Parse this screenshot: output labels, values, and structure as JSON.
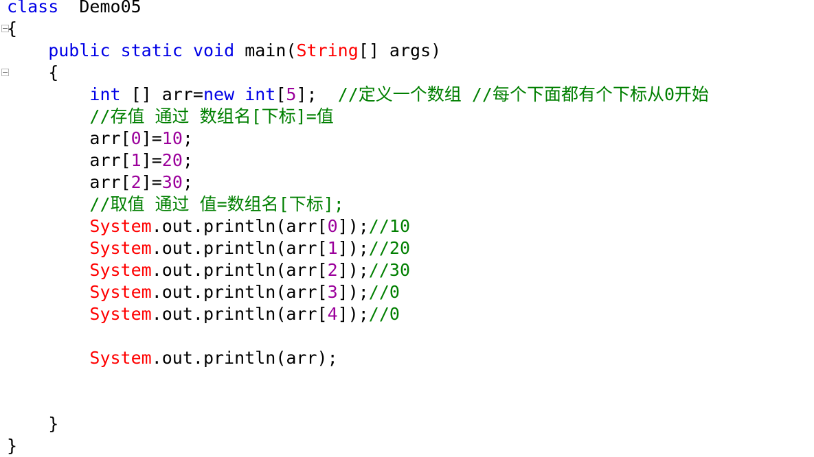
{
  "editor": {
    "language": "java",
    "class_name": "Demo05",
    "colors": {
      "background": "#FFFFFF",
      "plain_text": "#000000",
      "keyword": "#0000E6",
      "type_reference": "#FF0000",
      "number_literal": "#9B009B",
      "comment": "#007F00",
      "fold_marker_border": "#B4B4B4"
    },
    "fold_markers": [
      {
        "name": "class-body-fold",
        "line": 2,
        "state": "expanded",
        "glyph": "minus-box"
      },
      {
        "name": "method-body-fold",
        "line": 4,
        "state": "expanded",
        "glyph": "minus-box"
      }
    ],
    "lines": [
      {
        "num": 1,
        "indent": 0,
        "tokens": [
          {
            "t": "class",
            "c": "kw"
          },
          {
            "t": "  ",
            "c": "pln"
          },
          {
            "t": "Demo05",
            "c": "pln"
          }
        ]
      },
      {
        "num": 2,
        "indent": 0,
        "tokens": [
          {
            "t": "{",
            "c": "pln"
          }
        ]
      },
      {
        "num": 3,
        "indent": 4,
        "tokens": [
          {
            "t": "public",
            "c": "kw"
          },
          {
            "t": " ",
            "c": "pln"
          },
          {
            "t": "static",
            "c": "kw"
          },
          {
            "t": " ",
            "c": "pln"
          },
          {
            "t": "void",
            "c": "kw"
          },
          {
            "t": " main(",
            "c": "pln"
          },
          {
            "t": "String",
            "c": "cls"
          },
          {
            "t": "[] args)",
            "c": "pln"
          }
        ]
      },
      {
        "num": 4,
        "indent": 4,
        "tokens": [
          {
            "t": "{",
            "c": "pln"
          }
        ]
      },
      {
        "num": 5,
        "indent": 8,
        "tokens": [
          {
            "t": "int",
            "c": "kw"
          },
          {
            "t": " [] arr=",
            "c": "pln"
          },
          {
            "t": "new",
            "c": "kw"
          },
          {
            "t": " ",
            "c": "pln"
          },
          {
            "t": "int",
            "c": "kw"
          },
          {
            "t": "[",
            "c": "pln"
          },
          {
            "t": "5",
            "c": "num"
          },
          {
            "t": "];  ",
            "c": "pln"
          },
          {
            "t": "//定义一个数组 //每个下面都有个下标从0开始",
            "c": "cmt"
          }
        ]
      },
      {
        "num": 6,
        "indent": 8,
        "tokens": [
          {
            "t": "//存值 通过 数组名[下标]=值",
            "c": "cmt"
          }
        ]
      },
      {
        "num": 7,
        "indent": 8,
        "tokens": [
          {
            "t": "arr[",
            "c": "pln"
          },
          {
            "t": "0",
            "c": "num"
          },
          {
            "t": "]=",
            "c": "pln"
          },
          {
            "t": "10",
            "c": "num"
          },
          {
            "t": ";",
            "c": "pln"
          }
        ]
      },
      {
        "num": 8,
        "indent": 8,
        "tokens": [
          {
            "t": "arr[",
            "c": "pln"
          },
          {
            "t": "1",
            "c": "num"
          },
          {
            "t": "]=",
            "c": "pln"
          },
          {
            "t": "20",
            "c": "num"
          },
          {
            "t": ";",
            "c": "pln"
          }
        ]
      },
      {
        "num": 9,
        "indent": 8,
        "tokens": [
          {
            "t": "arr[",
            "c": "pln"
          },
          {
            "t": "2",
            "c": "num"
          },
          {
            "t": "]=",
            "c": "pln"
          },
          {
            "t": "30",
            "c": "num"
          },
          {
            "t": ";",
            "c": "pln"
          }
        ]
      },
      {
        "num": 10,
        "indent": 8,
        "tokens": [
          {
            "t": "//取值 通过 值=数组名[下标];",
            "c": "cmt"
          }
        ]
      },
      {
        "num": 11,
        "indent": 8,
        "tokens": [
          {
            "t": "System",
            "c": "cls"
          },
          {
            "t": ".out.println(arr[",
            "c": "pln"
          },
          {
            "t": "0",
            "c": "num"
          },
          {
            "t": "]);",
            "c": "pln"
          },
          {
            "t": "//10",
            "c": "cmt"
          }
        ]
      },
      {
        "num": 12,
        "indent": 8,
        "tokens": [
          {
            "t": "System",
            "c": "cls"
          },
          {
            "t": ".out.println(arr[",
            "c": "pln"
          },
          {
            "t": "1",
            "c": "num"
          },
          {
            "t": "]);",
            "c": "pln"
          },
          {
            "t": "//20",
            "c": "cmt"
          }
        ]
      },
      {
        "num": 13,
        "indent": 8,
        "tokens": [
          {
            "t": "System",
            "c": "cls"
          },
          {
            "t": ".out.println(arr[",
            "c": "pln"
          },
          {
            "t": "2",
            "c": "num"
          },
          {
            "t": "]);",
            "c": "pln"
          },
          {
            "t": "//30",
            "c": "cmt"
          }
        ]
      },
      {
        "num": 14,
        "indent": 8,
        "tokens": [
          {
            "t": "System",
            "c": "cls"
          },
          {
            "t": ".out.println(arr[",
            "c": "pln"
          },
          {
            "t": "3",
            "c": "num"
          },
          {
            "t": "]);",
            "c": "pln"
          },
          {
            "t": "//0",
            "c": "cmt"
          }
        ]
      },
      {
        "num": 15,
        "indent": 8,
        "tokens": [
          {
            "t": "System",
            "c": "cls"
          },
          {
            "t": ".out.println(arr[",
            "c": "pln"
          },
          {
            "t": "4",
            "c": "num"
          },
          {
            "t": "]);",
            "c": "pln"
          },
          {
            "t": "//0",
            "c": "cmt"
          }
        ]
      },
      {
        "num": 16,
        "indent": 0,
        "tokens": []
      },
      {
        "num": 17,
        "indent": 8,
        "tokens": [
          {
            "t": "System",
            "c": "cls"
          },
          {
            "t": ".out.println(arr);",
            "c": "pln"
          }
        ]
      },
      {
        "num": 18,
        "indent": 0,
        "tokens": []
      },
      {
        "num": 19,
        "indent": 0,
        "tokens": []
      },
      {
        "num": 20,
        "indent": 4,
        "tokens": [
          {
            "t": "}",
            "c": "pln"
          }
        ]
      },
      {
        "num": 21,
        "indent": 0,
        "tokens": [
          {
            "t": "}",
            "c": "pln"
          }
        ]
      }
    ]
  }
}
